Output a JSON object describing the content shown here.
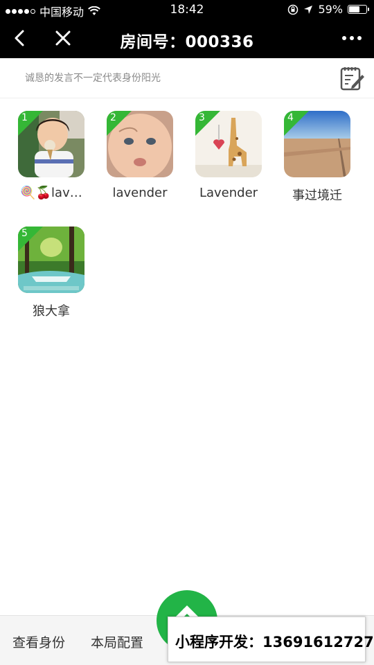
{
  "status_bar": {
    "carrier": "中国移动",
    "time": "18:42",
    "battery": "59%",
    "battery_level": 0.59
  },
  "nav": {
    "title": "房间号：000336"
  },
  "notice": {
    "text": "诚恳的发言不一定代表身份阳光"
  },
  "players": [
    {
      "number": "1",
      "name": "🍭🍒lav…"
    },
    {
      "number": "2",
      "name": "lavender"
    },
    {
      "number": "3",
      "name": "Lavender"
    },
    {
      "number": "4",
      "name": "事过境迁"
    },
    {
      "number": "5",
      "name": "狼大拿"
    }
  ],
  "bottom_bar": {
    "tabs": [
      "查看身份",
      "本局配置"
    ]
  },
  "promo": {
    "text": "小程序开发：13691612727"
  },
  "colors": {
    "badge_green": "#35b736",
    "fab_green": "#22b447"
  }
}
